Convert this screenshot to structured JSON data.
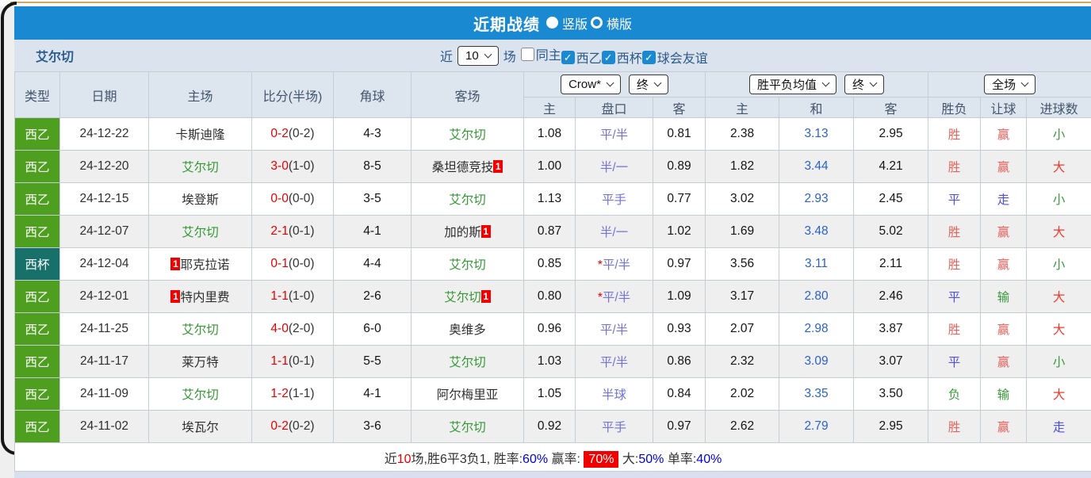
{
  "header": {
    "title": "近期战绩",
    "view_options": [
      {
        "label": "竖版",
        "selected": true
      },
      {
        "label": "横版",
        "selected": false
      }
    ]
  },
  "filter": {
    "team": "艾尔切",
    "near_label": "近",
    "match_count": "10",
    "field_label": "场",
    "checkboxes": [
      {
        "label": "同主",
        "checked": false
      },
      {
        "label": "西乙",
        "checked": true
      },
      {
        "label": "西杯",
        "checked": true
      },
      {
        "label": "球会友谊",
        "checked": true
      }
    ]
  },
  "table": {
    "columns": {
      "type": "类型",
      "date": "日期",
      "home": "主场",
      "score": "比分(半场)",
      "corner": "角球",
      "away": "客场",
      "odds_home": "主",
      "handicap": "盘口",
      "odds_away": "客",
      "avg_home": "主",
      "avg_draw": "和",
      "avg_away": "客",
      "wdl": "胜负",
      "let_ball": "让球",
      "goals": "进球数"
    },
    "selects": {
      "bookmaker": "Crow*",
      "final1": "终",
      "avg": "胜平负均值",
      "final2": "终",
      "fulltime": "全场"
    },
    "rows": [
      {
        "type": "西乙",
        "league": "liga",
        "date": "24-12-22",
        "home": {
          "name": "卡斯迪隆",
          "green": false,
          "badge": null
        },
        "score": {
          "ft": "0-2",
          "ht": "(0-2)"
        },
        "corner": "4-3",
        "away": {
          "name": "艾尔切",
          "green": true,
          "badge": null
        },
        "crow": {
          "h": "1.08",
          "hc": "平/半",
          "star": false,
          "a": "0.81"
        },
        "avg": {
          "h": "2.38",
          "d": "3.13",
          "a": "2.95"
        },
        "res": {
          "wdl": {
            "text": "胜",
            "color": "red"
          },
          "let": {
            "text": "赢",
            "color": "red"
          },
          "goal": {
            "text": "小",
            "color": "green"
          }
        }
      },
      {
        "type": "西乙",
        "league": "liga",
        "date": "24-12-20",
        "home": {
          "name": "艾尔切",
          "green": true,
          "badge": null
        },
        "score": {
          "ft": "3-0",
          "ht": "(1-0)"
        },
        "corner": "8-5",
        "away": {
          "name": "桑坦德竞技",
          "green": false,
          "badge": {
            "text": "1",
            "pos": "after"
          }
        },
        "crow": {
          "h": "1.00",
          "hc": "半/一",
          "star": false,
          "a": "0.89"
        },
        "avg": {
          "h": "1.82",
          "d": "3.44",
          "a": "4.21"
        },
        "res": {
          "wdl": {
            "text": "胜",
            "color": "red"
          },
          "let": {
            "text": "赢",
            "color": "red"
          },
          "goal": {
            "text": "大",
            "color": "bigred"
          }
        }
      },
      {
        "type": "西乙",
        "league": "liga",
        "date": "24-12-15",
        "home": {
          "name": "埃登斯",
          "green": false,
          "badge": null
        },
        "score": {
          "ft": "0-0",
          "ht": "(0-0)"
        },
        "corner": "3-5",
        "away": {
          "name": "艾尔切",
          "green": true,
          "badge": null
        },
        "crow": {
          "h": "1.13",
          "hc": "平手",
          "star": false,
          "a": "0.77"
        },
        "avg": {
          "h": "3.02",
          "d": "2.93",
          "a": "2.45"
        },
        "res": {
          "wdl": {
            "text": "平",
            "color": "blue"
          },
          "let": {
            "text": "走",
            "color": "blue"
          },
          "goal": {
            "text": "小",
            "color": "green"
          }
        }
      },
      {
        "type": "西乙",
        "league": "liga",
        "date": "24-12-07",
        "home": {
          "name": "艾尔切",
          "green": true,
          "badge": null
        },
        "score": {
          "ft": "2-1",
          "ht": "(0-1)"
        },
        "corner": "4-1",
        "away": {
          "name": "加的斯",
          "green": false,
          "badge": {
            "text": "1",
            "pos": "after"
          }
        },
        "crow": {
          "h": "0.87",
          "hc": "半/一",
          "star": false,
          "a": "1.02"
        },
        "avg": {
          "h": "1.69",
          "d": "3.48",
          "a": "5.02"
        },
        "res": {
          "wdl": {
            "text": "胜",
            "color": "red"
          },
          "let": {
            "text": "赢",
            "color": "red"
          },
          "goal": {
            "text": "大",
            "color": "bigred"
          }
        }
      },
      {
        "type": "西杯",
        "league": "cup",
        "date": "24-12-04",
        "home": {
          "name": "耶克拉诺",
          "green": false,
          "badge": {
            "text": "1",
            "pos": "before"
          }
        },
        "score": {
          "ft": "0-1",
          "ht": "(0-0)"
        },
        "corner": "4-4",
        "away": {
          "name": "艾尔切",
          "green": true,
          "badge": null
        },
        "crow": {
          "h": "0.85",
          "hc": "平/半",
          "star": true,
          "a": "0.97"
        },
        "avg": {
          "h": "3.56",
          "d": "3.11",
          "a": "2.11"
        },
        "res": {
          "wdl": {
            "text": "胜",
            "color": "red"
          },
          "let": {
            "text": "赢",
            "color": "red"
          },
          "goal": {
            "text": "小",
            "color": "green"
          }
        }
      },
      {
        "type": "西乙",
        "league": "liga",
        "date": "24-12-01",
        "home": {
          "name": "特内里费",
          "green": false,
          "badge": {
            "text": "1",
            "pos": "before"
          }
        },
        "score": {
          "ft": "1-1",
          "ht": "(1-0)"
        },
        "corner": "2-6",
        "away": {
          "name": "艾尔切",
          "green": true,
          "badge": {
            "text": "1",
            "pos": "after"
          }
        },
        "crow": {
          "h": "0.80",
          "hc": "平/半",
          "star": true,
          "a": "1.09"
        },
        "avg": {
          "h": "3.17",
          "d": "2.80",
          "a": "2.46"
        },
        "res": {
          "wdl": {
            "text": "平",
            "color": "blue"
          },
          "let": {
            "text": "输",
            "color": "green"
          },
          "goal": {
            "text": "大",
            "color": "bigred"
          }
        }
      },
      {
        "type": "西乙",
        "league": "liga",
        "date": "24-11-25",
        "home": {
          "name": "艾尔切",
          "green": true,
          "badge": null
        },
        "score": {
          "ft": "4-0",
          "ht": "(2-0)"
        },
        "corner": "6-0",
        "away": {
          "name": "奥维多",
          "green": false,
          "badge": null
        },
        "crow": {
          "h": "0.96",
          "hc": "平/半",
          "star": false,
          "a": "0.93"
        },
        "avg": {
          "h": "2.07",
          "d": "2.98",
          "a": "3.87"
        },
        "res": {
          "wdl": {
            "text": "胜",
            "color": "red"
          },
          "let": {
            "text": "赢",
            "color": "red"
          },
          "goal": {
            "text": "大",
            "color": "bigred"
          }
        }
      },
      {
        "type": "西乙",
        "league": "liga",
        "date": "24-11-17",
        "home": {
          "name": "莱万特",
          "green": false,
          "badge": null
        },
        "score": {
          "ft": "1-1",
          "ht": "(0-1)"
        },
        "corner": "5-5",
        "away": {
          "name": "艾尔切",
          "green": true,
          "badge": null
        },
        "crow": {
          "h": "1.03",
          "hc": "平/半",
          "star": false,
          "a": "0.86"
        },
        "avg": {
          "h": "2.32",
          "d": "3.09",
          "a": "3.07"
        },
        "res": {
          "wdl": {
            "text": "平",
            "color": "blue"
          },
          "let": {
            "text": "赢",
            "color": "red"
          },
          "goal": {
            "text": "小",
            "color": "green"
          }
        }
      },
      {
        "type": "西乙",
        "league": "liga",
        "date": "24-11-09",
        "home": {
          "name": "艾尔切",
          "green": true,
          "badge": null
        },
        "score": {
          "ft": "1-2",
          "ht": "(1-1)"
        },
        "corner": "4-1",
        "away": {
          "name": "阿尔梅里亚",
          "green": false,
          "badge": null
        },
        "crow": {
          "h": "1.05",
          "hc": "半球",
          "star": false,
          "a": "0.84"
        },
        "avg": {
          "h": "2.02",
          "d": "3.35",
          "a": "3.50"
        },
        "res": {
          "wdl": {
            "text": "负",
            "color": "green"
          },
          "let": {
            "text": "输",
            "color": "green"
          },
          "goal": {
            "text": "大",
            "color": "bigred"
          }
        }
      },
      {
        "type": "西乙",
        "league": "liga",
        "date": "24-11-02",
        "home": {
          "name": "埃瓦尔",
          "green": false,
          "badge": null
        },
        "score": {
          "ft": "0-2",
          "ht": "(0-2)"
        },
        "corner": "3-6",
        "away": {
          "name": "艾尔切",
          "green": true,
          "badge": null
        },
        "crow": {
          "h": "0.92",
          "hc": "平手",
          "star": false,
          "a": "0.97"
        },
        "avg": {
          "h": "2.62",
          "d": "2.79",
          "a": "2.95"
        },
        "res": {
          "wdl": {
            "text": "胜",
            "color": "red"
          },
          "let": {
            "text": "赢",
            "color": "red"
          },
          "goal": {
            "text": "走",
            "color": "blue"
          }
        }
      }
    ]
  },
  "summary": {
    "segments": [
      {
        "text": "近",
        "style": "dark"
      },
      {
        "text": "10",
        "style": "red"
      },
      {
        "text": "场,胜6平3负1, ",
        "style": "dark"
      },
      {
        "text": "胜率:",
        "style": "dark"
      },
      {
        "text": "60%",
        "style": "blue"
      },
      {
        "text": " 赢率: ",
        "style": "dark"
      },
      {
        "text": "70%",
        "style": "redbg"
      },
      {
        "text": " 大:",
        "style": "dark"
      },
      {
        "text": "50%",
        "style": "blue"
      },
      {
        "text": " 单率:",
        "style": "dark"
      },
      {
        "text": "40%",
        "style": "blue"
      }
    ]
  },
  "colors": {
    "accent_blue": "#1989d1",
    "filter_bg": "#dbe3ef",
    "header_bg": "#dde5ef",
    "league_green": "#4e9e20",
    "cup_teal": "#17706a",
    "team_green": "#339933",
    "score_red": "#e80000",
    "handicap_blue": "#7373d9",
    "avg_draw_blue": "#2b62c9",
    "win_red": "#e2625d",
    "big_red": "#ee3a2e",
    "result_green": "#3a9a3c",
    "result_blue": "#4f4fe2",
    "summary_highlight_bg": "#f00000"
  }
}
